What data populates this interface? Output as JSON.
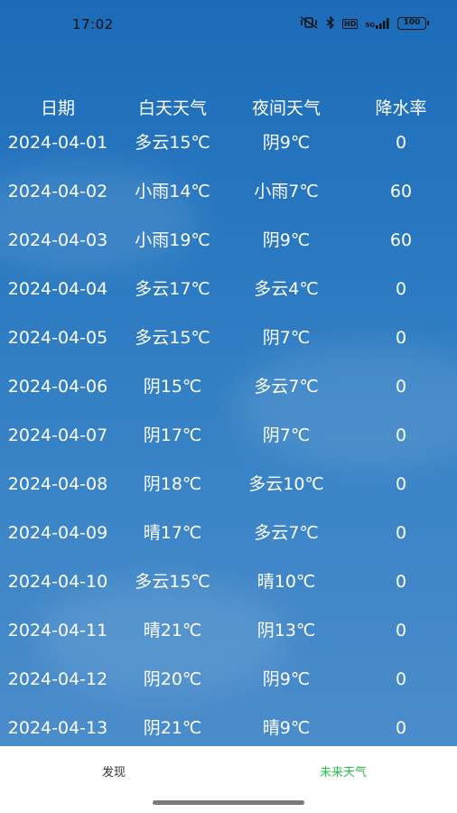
{
  "status_bar": {
    "time": "17:02",
    "icons": [
      "mute-vibrate-icon",
      "bluetooth-icon",
      "hd-icon",
      "signal-5g-icon",
      "battery-icon"
    ],
    "hd_label": "HD",
    "network_label": "5G",
    "battery_level": "100"
  },
  "table": {
    "headers": {
      "date": "日期",
      "day": "白天天气",
      "night": "夜间天气",
      "rain": "降水率"
    },
    "rows": [
      {
        "date": "2024-04-01",
        "day": "多云15℃",
        "night": "阴9℃",
        "rain": "0"
      },
      {
        "date": "2024-04-02",
        "day": "小雨14℃",
        "night": "小雨7℃",
        "rain": "60"
      },
      {
        "date": "2024-04-03",
        "day": "小雨19℃",
        "night": "阴9℃",
        "rain": "60"
      },
      {
        "date": "2024-04-04",
        "day": "多云17℃",
        "night": "多云4℃",
        "rain": "0"
      },
      {
        "date": "2024-04-05",
        "day": "多云15℃",
        "night": "阴7℃",
        "rain": "0"
      },
      {
        "date": "2024-04-06",
        "day": "阴15℃",
        "night": "多云7℃",
        "rain": "0"
      },
      {
        "date": "2024-04-07",
        "day": "阴17℃",
        "night": "阴7℃",
        "rain": "0"
      },
      {
        "date": "2024-04-08",
        "day": "阴18℃",
        "night": "多云10℃",
        "rain": "0"
      },
      {
        "date": "2024-04-09",
        "day": "晴17℃",
        "night": "多云7℃",
        "rain": "0"
      },
      {
        "date": "2024-04-10",
        "day": "多云15℃",
        "night": "晴10℃",
        "rain": "0"
      },
      {
        "date": "2024-04-11",
        "day": "晴21℃",
        "night": "阴13℃",
        "rain": "0"
      },
      {
        "date": "2024-04-12",
        "day": "阴20℃",
        "night": "阴9℃",
        "rain": "0"
      },
      {
        "date": "2024-04-13",
        "day": "阴21℃",
        "night": "晴9℃",
        "rain": "0"
      }
    ]
  },
  "bottom_nav": {
    "items": [
      {
        "label": "发现",
        "active": false
      },
      {
        "label": "未来天气",
        "active": true
      }
    ],
    "active_color": "#27c24c"
  },
  "colors": {
    "background_top": "#1b6bb8",
    "background_bottom": "#4b8ccb",
    "text": "#ffffff"
  }
}
